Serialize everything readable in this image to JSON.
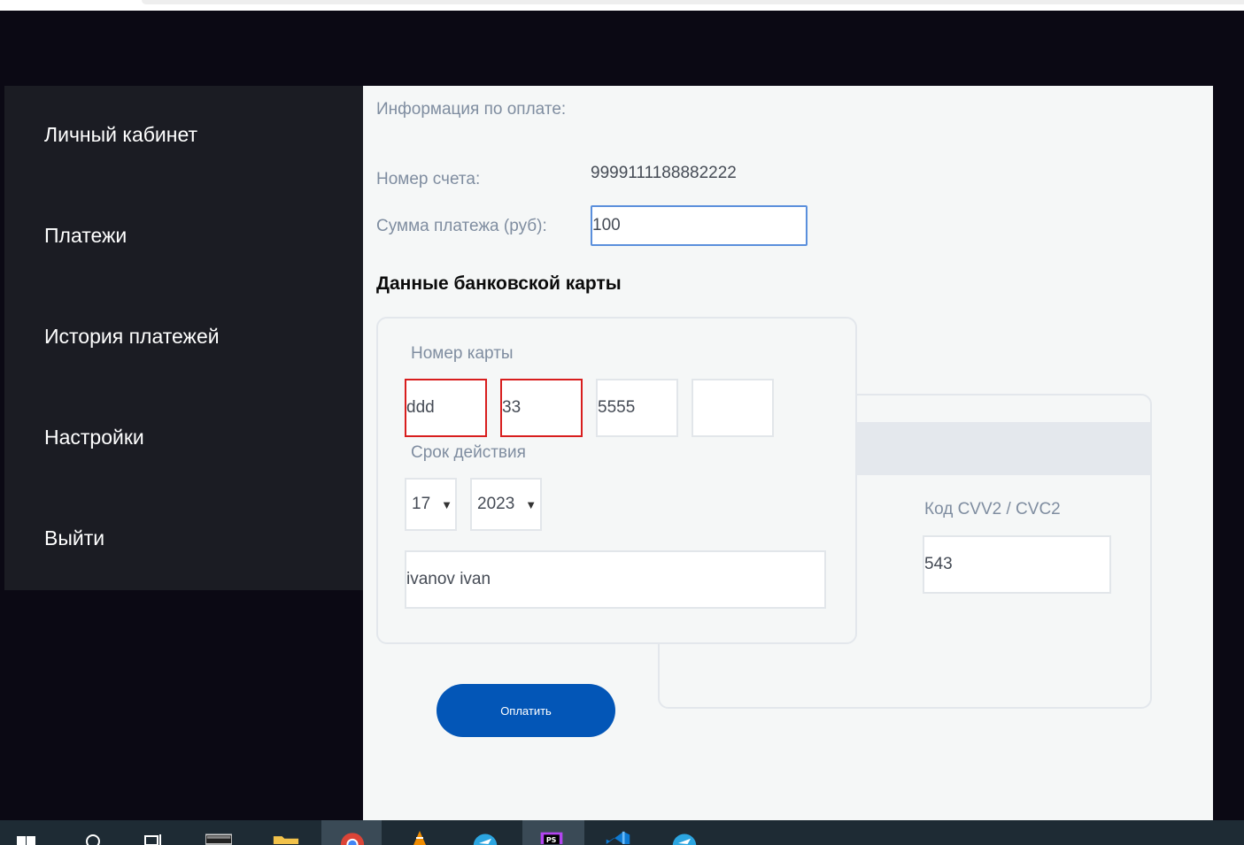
{
  "sidebar": {
    "items": [
      {
        "label": "Личный кабинет"
      },
      {
        "label": "Платежи"
      },
      {
        "label": "История платежей"
      },
      {
        "label": "Настройки"
      },
      {
        "label": "Выйти"
      }
    ]
  },
  "payment": {
    "info_title": "Информация по оплате:",
    "account_label": "Номер счета:",
    "account_value": "9999111188882222",
    "amount_label": "Сумма платежа (руб):",
    "amount_value": "100"
  },
  "card": {
    "section_title": "Данные банковской карты",
    "number_label": "Номер карты",
    "number_parts": [
      "ddd",
      "33",
      "5555",
      ""
    ],
    "expiry_label": "Срок действия",
    "expiry_month": "17",
    "expiry_year": "2023",
    "holder_value": "ivanov ivan",
    "cvv_label": "Код CVV2 / CVC2",
    "cvv_value": "543"
  },
  "actions": {
    "pay_label": "Оплатить"
  },
  "colors": {
    "accent": "#0356b7",
    "error": "#d81e1e",
    "sidebar_bg": "#1b1c23",
    "page_bg": "#0b0914"
  },
  "taskbar": {
    "icons": [
      "windows-start-icon",
      "search-icon",
      "task-view-icon",
      "terminal-icon",
      "file-explorer-icon",
      "chrome-icon",
      "vlc-icon",
      "telegram-icon",
      "phpstorm-icon",
      "vscode-icon",
      "telegram-icon"
    ]
  }
}
